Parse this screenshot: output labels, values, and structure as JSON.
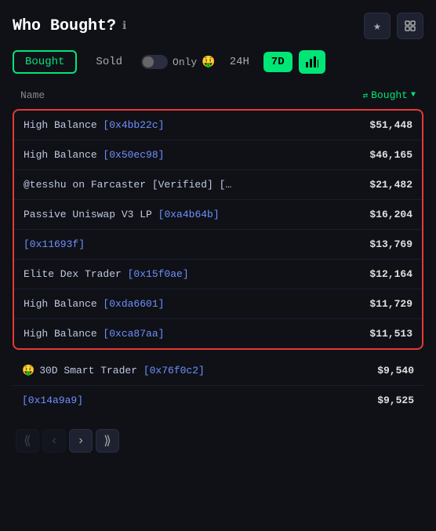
{
  "header": {
    "title": "Who Bought?",
    "info_icon": "ℹ",
    "star_icon": "★",
    "expand_icon": "⛶"
  },
  "toolbar": {
    "tab_bought": "Bought",
    "tab_sold": "Sold",
    "toggle_label": "Only",
    "toggle_emoji": "🤑",
    "time_24h": "24H",
    "time_7d": "7D",
    "active_tab": "Bought",
    "active_time": "7D"
  },
  "table": {
    "col_name": "Name",
    "col_bought": "Bought",
    "col_sort_icon": "▼",
    "col_toggle_icon": "⇄",
    "highlighted_rows": [
      {
        "name": "High Balance [0x4bb22c]",
        "addr_color": true,
        "value": "$51,448"
      },
      {
        "name": "High Balance [0x50ec98]",
        "addr_color": true,
        "value": "$46,165"
      },
      {
        "name": "@tesshu on Farcaster [Verified] […",
        "addr_color": false,
        "value": "$21,482"
      },
      {
        "name": "Passive Uniswap V3 LP [0xa4b64b]",
        "addr_color": true,
        "value": "$16,204"
      },
      {
        "name": "[0x11693f]",
        "addr_color": true,
        "value": "$13,769"
      },
      {
        "name": "Elite Dex Trader [0x15f0ae]",
        "addr_color": true,
        "value": "$12,164"
      },
      {
        "name": "High Balance [0xda6601]",
        "addr_color": true,
        "value": "$11,729"
      },
      {
        "name": "High Balance [0xca87aa]",
        "addr_color": true,
        "value": "$11,513"
      }
    ],
    "extra_rows": [
      {
        "name": "30D Smart Trader [0x76f0c2]",
        "emoji": "🤑",
        "value": "$9,540"
      },
      {
        "name": "[0x14a9a9]",
        "emoji": null,
        "value": "$9,525"
      }
    ]
  },
  "pagination": {
    "first": "«",
    "prev": "‹",
    "next": "›",
    "last": "»"
  }
}
